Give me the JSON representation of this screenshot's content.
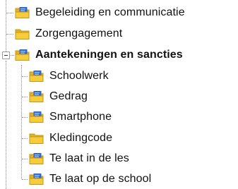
{
  "tree": {
    "items": [
      {
        "label": "Begeleiding en communicatie",
        "icon": "folder-with-document-icon",
        "level": 0
      },
      {
        "label": "Zorgengagement",
        "icon": "folder-icon",
        "level": 0
      },
      {
        "label": "Aantekeningen en sancties",
        "icon": "folder-with-document-icon",
        "level": 0,
        "expanded": true,
        "bold": true
      },
      {
        "label": "Schoolwerk",
        "icon": "folder-with-document-icon",
        "level": 1
      },
      {
        "label": "Gedrag",
        "icon": "folder-with-document-icon",
        "level": 1
      },
      {
        "label": "Smartphone",
        "icon": "folder-with-document-icon",
        "level": 1
      },
      {
        "label": "Kledingcode",
        "icon": "folder-icon",
        "level": 1
      },
      {
        "label": "Te laat in de les",
        "icon": "folder-with-document-icon",
        "level": 1
      },
      {
        "label": "Te laat op de school",
        "icon": "folder-with-document-icon",
        "level": 1
      }
    ]
  },
  "colors": {
    "folder_yellow": "#f5cc3c",
    "folder_shade": "#e3b021",
    "folder_edge": "#c89310",
    "document_blue": "#2e69cf",
    "text": "#111111",
    "tree_line": "#8c8c8c"
  }
}
